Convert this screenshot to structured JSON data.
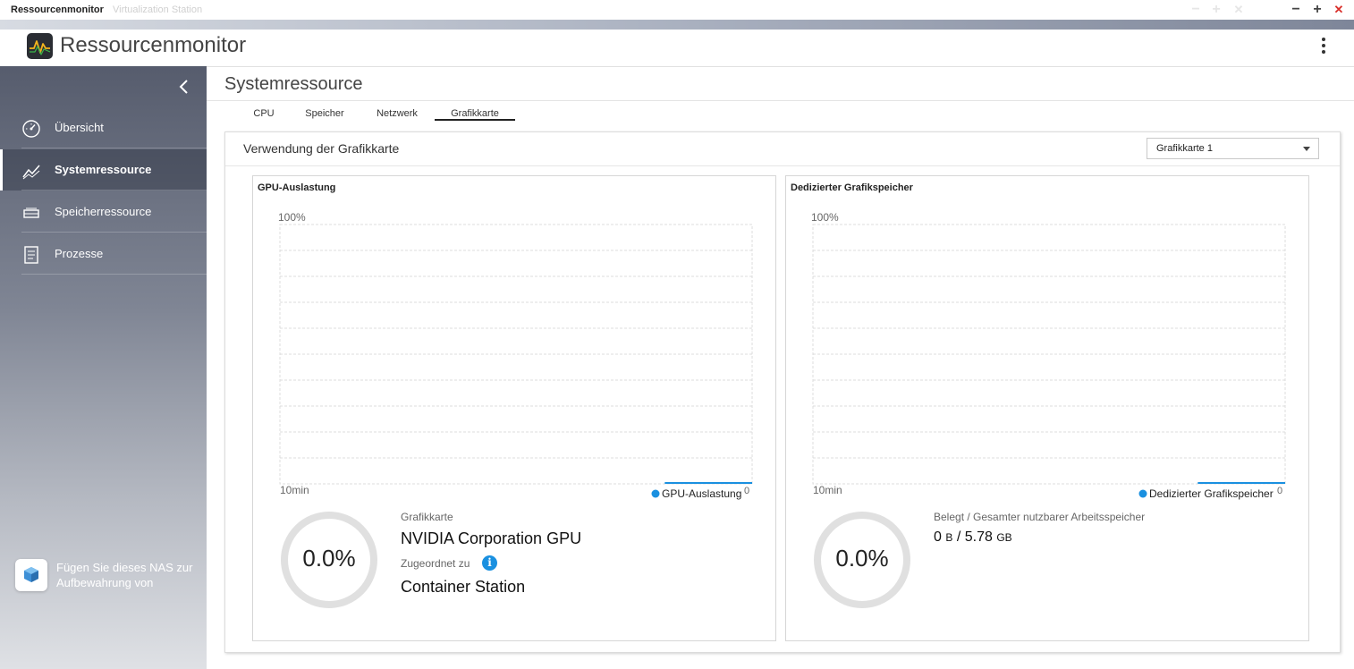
{
  "window": {
    "tabs": [
      {
        "label": "Ressourcenmonitor",
        "active": true
      },
      {
        "label": "Virtualization Station",
        "active": false
      }
    ],
    "controls": {
      "minimize": "−",
      "maximize": "+",
      "close": "✕"
    }
  },
  "app": {
    "title": "Ressourcenmonitor"
  },
  "sidebar": {
    "items": [
      {
        "label": "Übersicht",
        "icon": "speedometer-icon",
        "active": false
      },
      {
        "label": "Systemressource",
        "icon": "chart-line-icon",
        "active": true
      },
      {
        "label": "Speicherressource",
        "icon": "storage-drive-icon",
        "active": false
      },
      {
        "label": "Prozesse",
        "icon": "process-list-icon",
        "active": false
      }
    ],
    "promo_text": "Fügen Sie dieses NAS zur Aufbewahrung von"
  },
  "main": {
    "title": "Systemressource",
    "subtabs": [
      {
        "label": "CPU",
        "active": false
      },
      {
        "label": "Speicher",
        "active": false
      },
      {
        "label": "Netzwerk",
        "active": false
      },
      {
        "label": "Grafikkarte",
        "active": true
      }
    ],
    "panel": {
      "title": "Verwendung der Grafikkarte",
      "select_value": "Grafikkarte 1"
    },
    "gpu_card": {
      "title": "GPU-Auslastung",
      "y_max_label": "100%",
      "x_left_label": "10min",
      "x_right_label": "0",
      "legend": "GPU-Auslastung",
      "gauge_value": "0.0%",
      "label_card": "Grafikkarte",
      "value_card": "NVIDIA Corporation GPU",
      "label_assigned": "Zugeordnet zu",
      "value_assigned": "Container Station"
    },
    "mem_card": {
      "title": "Dedizierter Grafikspeicher",
      "y_max_label": "100%",
      "x_left_label": "10min",
      "x_right_label": "0",
      "legend": "Dedizierter Grafikspeicher",
      "gauge_value": "0.0%",
      "label_used_total": "Belegt / Gesamter nutzbarer Arbeitsspeicher",
      "used_num": "0",
      "used_unit": "B",
      "separator": "/",
      "total_num": "5.78",
      "total_unit": "GB"
    }
  },
  "colors": {
    "accent": "#1a90e0",
    "gauge_track": "#e0e0e0",
    "grid": "#dcdcdc"
  },
  "chart_data": [
    {
      "type": "area",
      "title": "GPU-Auslastung",
      "x": [
        "10min",
        "0"
      ],
      "series": [
        {
          "name": "GPU-Auslastung",
          "values": [
            0,
            0
          ]
        }
      ],
      "ylim": [
        0,
        100
      ],
      "grid": true,
      "legend": "bottom-right"
    },
    {
      "type": "area",
      "title": "Dedizierter Grafikspeicher",
      "x": [
        "10min",
        "0"
      ],
      "series": [
        {
          "name": "Dedizierter Grafikspeicher",
          "values": [
            0,
            0
          ]
        }
      ],
      "ylim": [
        0,
        100
      ],
      "grid": true,
      "legend": "bottom-right"
    }
  ]
}
